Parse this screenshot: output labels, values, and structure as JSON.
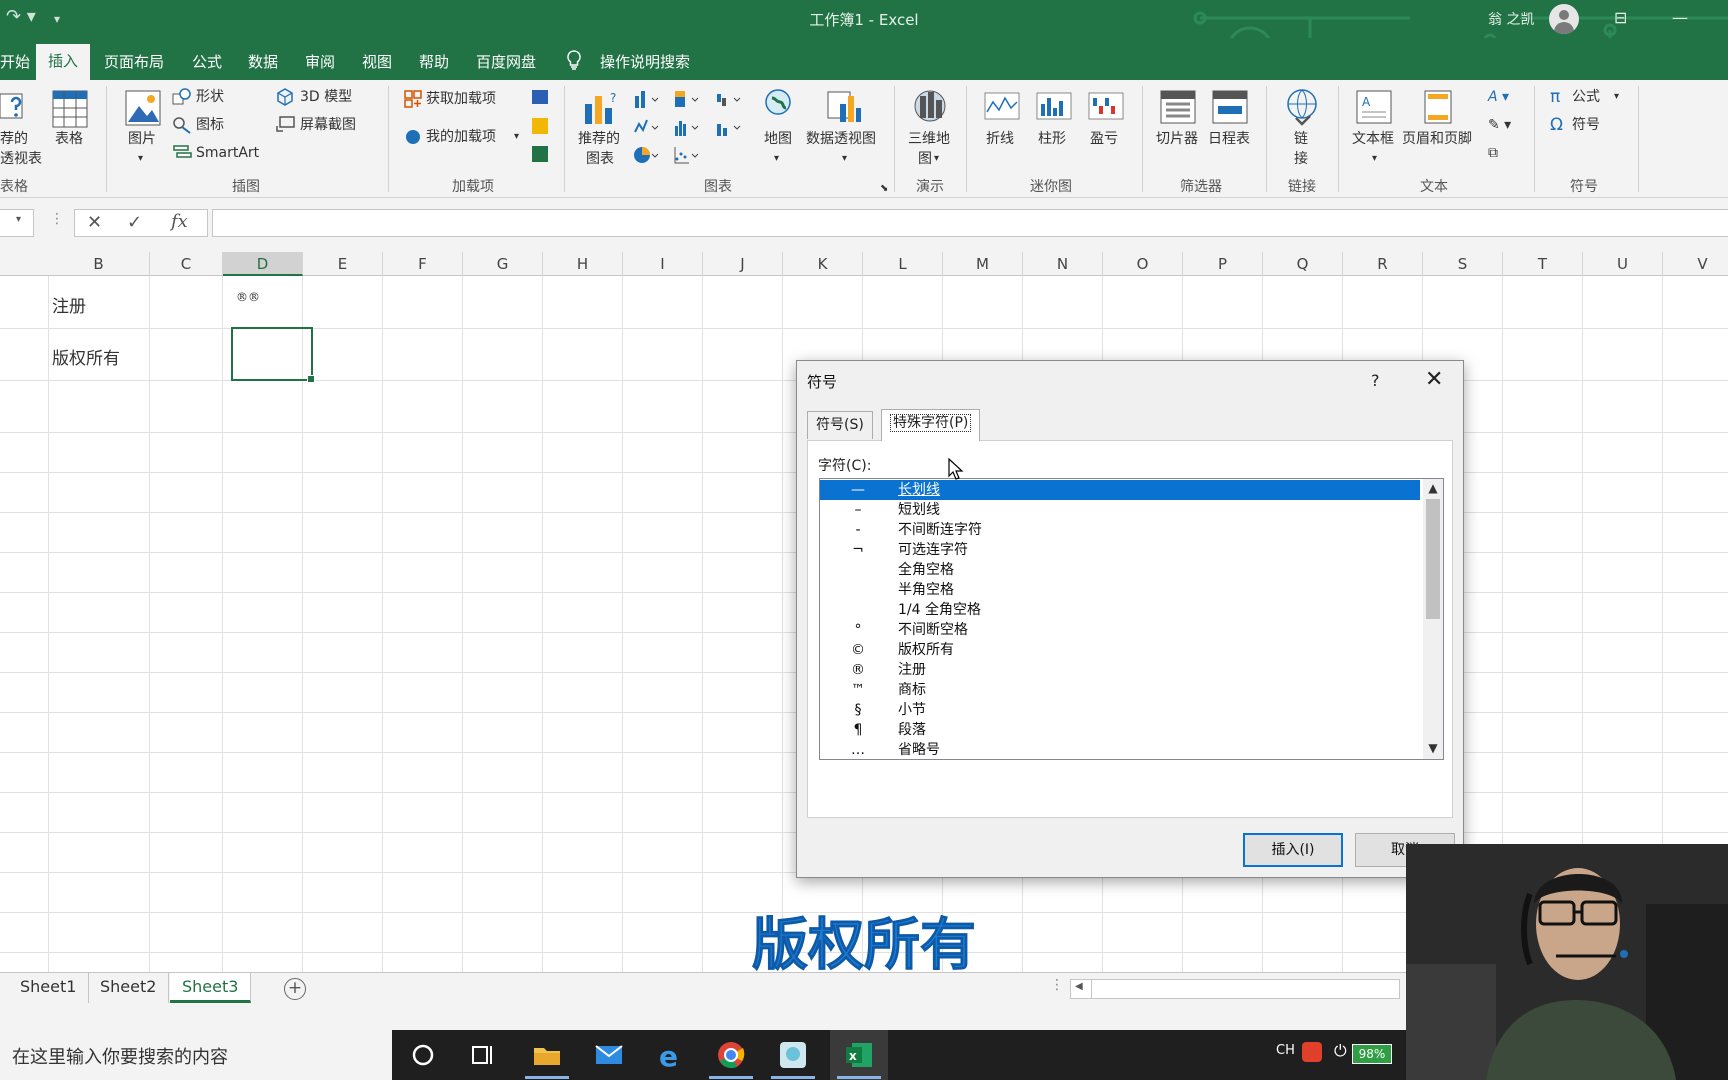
{
  "window": {
    "title": "工作簿1 - Excel",
    "user": "翁 之凯"
  },
  "tabs": [
    {
      "label": "开始"
    },
    {
      "label": "插入",
      "active": true
    },
    {
      "label": "页面布局"
    },
    {
      "label": "公式"
    },
    {
      "label": "数据"
    },
    {
      "label": "审阅"
    },
    {
      "label": "视图"
    },
    {
      "label": "帮助"
    },
    {
      "label": "百度网盘"
    },
    {
      "label": "操作说明搜索"
    }
  ],
  "ribbon": {
    "tables": {
      "pivot_line1": "荐的",
      "pivot_line2": "透视表",
      "table": "表格",
      "group": "表格"
    },
    "illustrations": {
      "picture": "图片",
      "shapes": "形状",
      "icons": "图标",
      "smartart": "SmartArt",
      "model3d": "3D 模型",
      "screenshot": "屏幕截图",
      "group": "插图"
    },
    "addins": {
      "get": "获取加载项",
      "my": "我的加载项",
      "group": "加载项"
    },
    "charts": {
      "recommended_line1": "推荐的",
      "recommended_line2": "图表",
      "map": "地图",
      "pivotchart": "数据透视图",
      "group": "图表"
    },
    "tours": {
      "map3d_line1": "三维地",
      "map3d_line2": "图",
      "group": "演示"
    },
    "sparklines": {
      "line": "折线",
      "column": "柱形",
      "winloss": "盈亏",
      "group": "迷你图"
    },
    "filters": {
      "slicer": "切片器",
      "timeline": "日程表",
      "group": "筛选器"
    },
    "links": {
      "link_line1": "链",
      "link_line2": "接",
      "group": "链接"
    },
    "text": {
      "textbox": "文本框",
      "headerfooter": "页眉和页脚",
      "group": "文本"
    },
    "symbols": {
      "equation": "公式",
      "symbol": "符号",
      "group": "符号"
    }
  },
  "formula_bar": {
    "fx": "fx",
    "value": ""
  },
  "columns": [
    "B",
    "C",
    "D",
    "E",
    "F",
    "G",
    "H",
    "I",
    "J",
    "K",
    "L",
    "M",
    "N",
    "O",
    "P",
    "Q",
    "R",
    "S",
    "T",
    "U",
    "V"
  ],
  "selected_column": "D",
  "cells": {
    "b_row1": "注册",
    "b_row2": "版权所有",
    "d_row1": "®®"
  },
  "caption": "版权所有",
  "sheets": [
    {
      "label": "Sheet1"
    },
    {
      "label": "Sheet2"
    },
    {
      "label": "Sheet3",
      "active": true
    }
  ],
  "dialog": {
    "title": "符号",
    "help": "?",
    "tab_symbols": "符号(S)",
    "tab_special": "特殊字符(P)",
    "char_label": "字符(C):",
    "items": [
      {
        "symbol": "—",
        "name": "长划线",
        "selected": true
      },
      {
        "symbol": "–",
        "name": "短划线"
      },
      {
        "symbol": "-",
        "name": "不间断连字符"
      },
      {
        "symbol": "¬",
        "name": "可选连字符"
      },
      {
        "symbol": "",
        "name": "全角空格"
      },
      {
        "symbol": "",
        "name": "半角空格"
      },
      {
        "symbol": "",
        "name": "1/4 全角空格"
      },
      {
        "symbol": "°",
        "name": "不间断空格"
      },
      {
        "symbol": "©",
        "name": "版权所有"
      },
      {
        "symbol": "®",
        "name": "注册"
      },
      {
        "symbol": "™",
        "name": "商标"
      },
      {
        "symbol": "§",
        "name": "小节"
      },
      {
        "symbol": "¶",
        "name": "段落"
      },
      {
        "symbol": "…",
        "name": "省略号"
      }
    ],
    "insert_button": "插入(I)",
    "cancel_button": "取消"
  },
  "taskbar": {
    "search_placeholder": "在这里输入你要搜索的内容",
    "lang": "CH",
    "battery": "98%"
  },
  "colors": {
    "excel_green": "#217346",
    "selection_blue": "#0a73d1",
    "caption_blue": "#1e7bd3"
  }
}
